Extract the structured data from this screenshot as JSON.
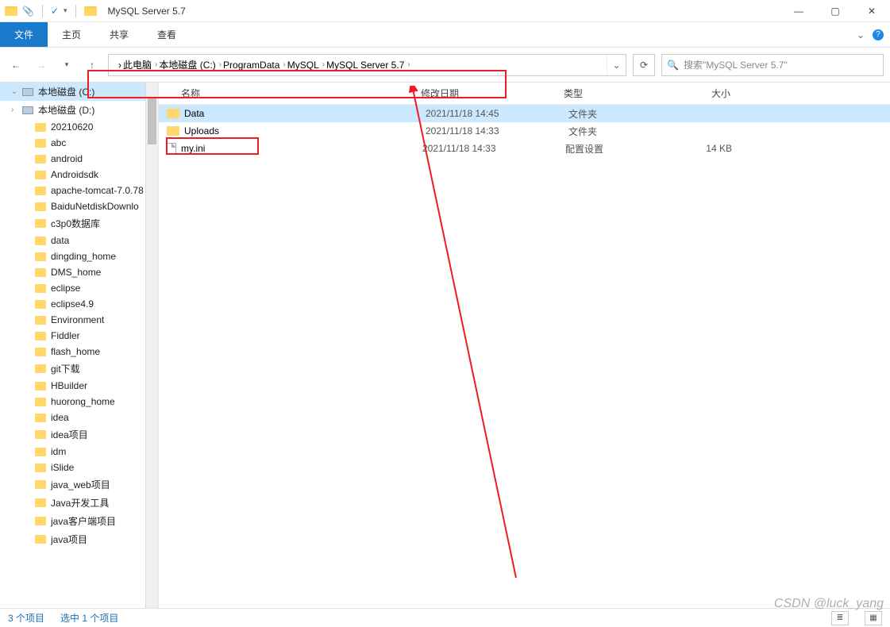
{
  "window": {
    "title": "MySQL Server 5.7"
  },
  "ribbon": {
    "file": "文件",
    "tabs": [
      "主页",
      "共享",
      "查看"
    ]
  },
  "breadcrumbs": [
    "此电脑",
    "本地磁盘 (C:)",
    "ProgramData",
    "MySQL",
    "MySQL Server 5.7"
  ],
  "search": {
    "placeholder": "搜索\"MySQL Server 5.7\""
  },
  "sidebar": {
    "drives": [
      {
        "label": "本地磁盘 (C:)",
        "selected": true
      },
      {
        "label": "本地磁盘 (D:)",
        "selected": false
      }
    ],
    "folders": [
      "20210620",
      "abc",
      "android",
      "Androidsdk",
      "apache-tomcat-7.0.78",
      "BaiduNetdiskDownlo",
      "c3p0数据库",
      "data",
      "dingding_home",
      "DMS_home",
      "eclipse",
      "eclipse4.9",
      "Environment",
      "Fiddler",
      "flash_home",
      "git下载",
      "HBuilder",
      "huorong_home",
      "idea",
      "idea项目",
      "idm",
      "iSlide",
      "java_web项目",
      "Java开发工具",
      "java客户端项目",
      "java项目"
    ]
  },
  "columns": {
    "name": "名称",
    "date": "修改日期",
    "type": "类型",
    "size": "大小"
  },
  "files": [
    {
      "icon": "folder",
      "name": "Data",
      "date": "2021/11/18 14:45",
      "type": "文件夹",
      "size": "",
      "selected": true
    },
    {
      "icon": "folder",
      "name": "Uploads",
      "date": "2021/11/18 14:33",
      "type": "文件夹",
      "size": "",
      "selected": false
    },
    {
      "icon": "file",
      "name": "my.ini",
      "date": "2021/11/18 14:33",
      "type": "配置设置",
      "size": "14 KB",
      "selected": false
    }
  ],
  "status": {
    "count": "3 个项目",
    "selected": "选中 1 个项目"
  },
  "watermark": "CSDN @luck_yang"
}
